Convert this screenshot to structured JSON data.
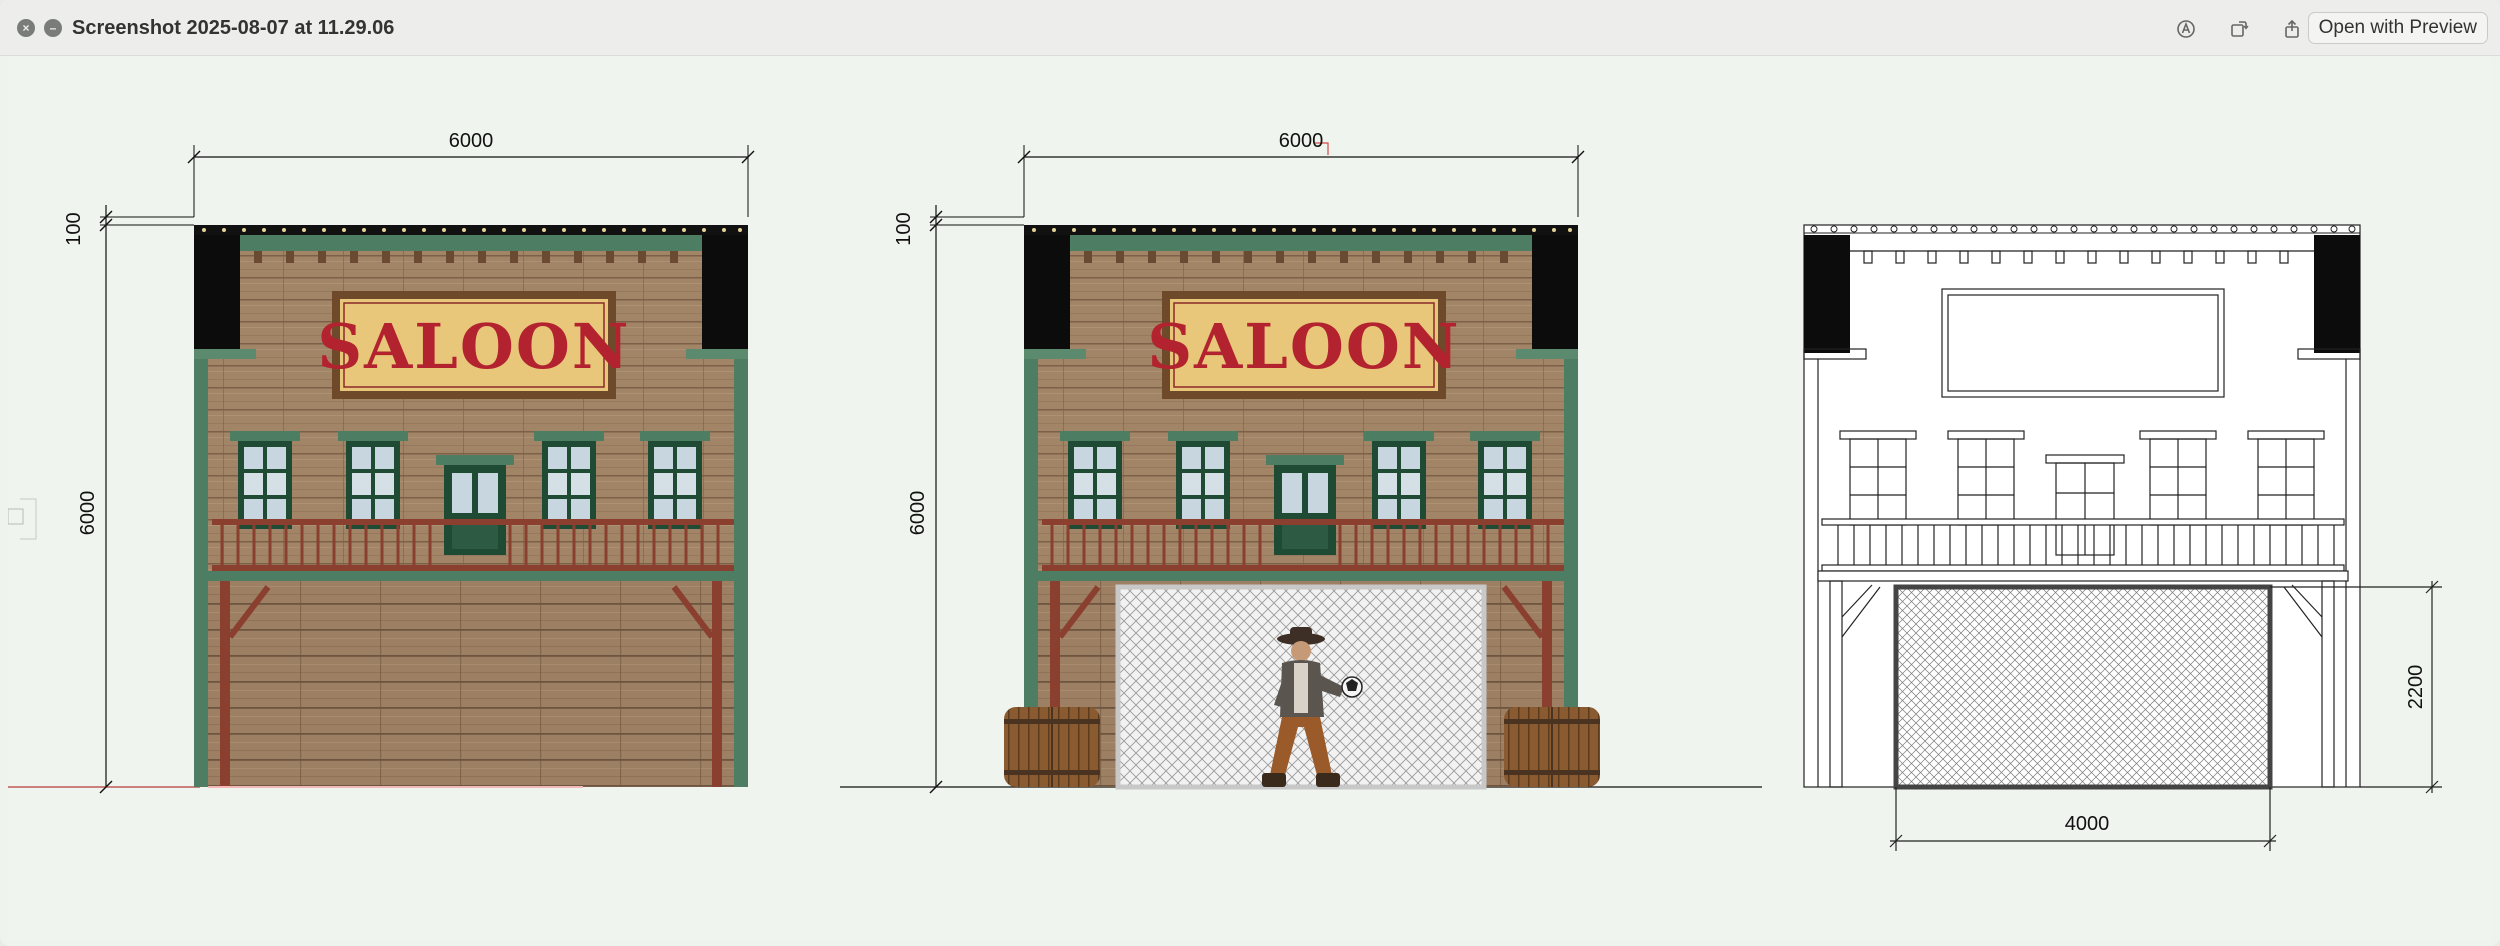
{
  "window": {
    "title": "Screenshot 2025-08-07 at 11.29.06",
    "open_button_label": "Open with Preview",
    "toolbar_icons": [
      "markup-icon",
      "rotate-icon",
      "share-icon"
    ]
  },
  "drawing": {
    "elevation_1": {
      "width_label": "6000",
      "top_label": "100",
      "height_label": "6000",
      "sign_text": "SALOON"
    },
    "elevation_2": {
      "width_label": "6000",
      "top_label": "100",
      "height_label": "6000",
      "sign_text": "SALOON"
    },
    "elevation_3": {
      "goal_width_label": "4000",
      "goal_height_label": "2200"
    }
  },
  "colors": {
    "wood": "#a28466",
    "wood_dark": "#7c6149",
    "trim_green": "#4d7d62",
    "black_panel": "#0c0c0c",
    "sign_gold": "#e8c77a",
    "sign_red": "#b3232f"
  }
}
